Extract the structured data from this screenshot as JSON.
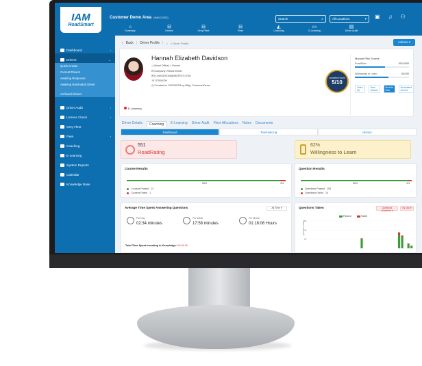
{
  "app": {
    "logo_line1": "IAM",
    "logo_line2": "RoadSmart",
    "title": "Customer Demo Area",
    "title_code": "(IMAC0203)",
    "search_placeholder": "Search",
    "location_value": "All Locations"
  },
  "nav_tiles": [
    {
      "label": "Summary",
      "icon": "home-icon"
    },
    {
      "label": "Drivers",
      "icon": "car-icon"
    },
    {
      "label": "Grey Fleet",
      "icon": "car-icon"
    },
    {
      "label": "Fleet",
      "icon": "car-icon"
    },
    {
      "label": "Coaching",
      "icon": "grad-cap-icon"
    },
    {
      "label": "E-Learning",
      "icon": "monitor-icon"
    },
    {
      "label": "Driver Audit",
      "icon": "clipboard-icon"
    }
  ],
  "sidebar": {
    "items": [
      {
        "label": "Dashboard"
      },
      {
        "label": "Drivers"
      }
    ],
    "driver_sub": [
      "Quick Create",
      "Current Drivers",
      "Awaiting Response",
      "Awaiting Nominated Driver",
      "Archived Drivers"
    ],
    "items2": [
      {
        "label": "Driver Audit"
      },
      {
        "label": "Licence Check"
      },
      {
        "label": "Grey Fleet"
      },
      {
        "label": "Fleet"
      },
      {
        "label": "Coaching"
      },
      {
        "label": "E-Learning"
      },
      {
        "label": "System Reports"
      },
      {
        "label": "Calendar"
      },
      {
        "label": "Knowledge Base"
      }
    ]
  },
  "breadcrumb": {
    "back": "Back",
    "title": "Driver Profile",
    "path": "> Driver Profile"
  },
  "actions_label": "Actions",
  "profile": {
    "name": "Hannah Elizabeth Davidson",
    "details": [
      "(Head Office) > Drivers",
      "Company Vehicle Driver",
      "H.DAVIDSON@IAMTEST.COM",
      "07000000",
      "Created on 15/03/2023 by Billy | CustomerDemo"
    ],
    "elearning_tag": "E-Learning",
    "combined_score_label": "Combined Score",
    "combined_score": "5/10"
  },
  "risk": {
    "title": "Module Risk Scores",
    "rows": [
      {
        "label": "RoadRider",
        "value": "551/1000",
        "fill": 0.551
      },
      {
        "label": "Willingness to Learn",
        "value": "62/100",
        "fill": 0.62
      }
    ],
    "tabs": [
      "Video (0)",
      "User Access",
      "Module Risk",
      "Nominated Drivers"
    ],
    "active_tab": "Module Risk"
  },
  "profile_tabs": [
    "Driver Details",
    "Coaching",
    "E-Learning",
    "Driver Audit",
    "Fleet Allocations",
    "Notes",
    "Documents"
  ],
  "profile_tab_active": "Coaching",
  "subtabs": [
    "Dashboard",
    "Telematics",
    "History"
  ],
  "subtab_active": "Dashboard",
  "road_rating": {
    "value": "551",
    "label": "RoadRating"
  },
  "willingness": {
    "value": "62%",
    "label": "Willingness to Learn"
  },
  "course_results": {
    "title": "Course Results",
    "passed_pct": 96,
    "failed_pct": 4,
    "passed_label": "96%",
    "failed_label": "4%",
    "legend": [
      {
        "label": "Courses Passed",
        "count": "22",
        "color": "#3a9c3a"
      },
      {
        "label": "Courses Failed",
        "count": "1",
        "color": "#d33333"
      }
    ]
  },
  "question_results": {
    "title": "Question Results",
    "passed_pct": 96,
    "failed_pct": 4,
    "passed_label": "96%",
    "failed_label": "4%",
    "legend": [
      {
        "label": "Questions Passed",
        "count": "105",
        "color": "#3a9c3a"
      },
      {
        "label": "Questions Failed",
        "count": "10",
        "color": "#d33333"
      }
    ]
  },
  "time_spent": {
    "title": "Average Time Spent Answering Questions",
    "dropdown": "All Time",
    "items": [
      {
        "period": "Per Day",
        "value": "02:34 minutes"
      },
      {
        "period": "Per Week",
        "value": "17:58 minutes"
      },
      {
        "period": "Per Month",
        "value": "01:18:06 Hours"
      }
    ],
    "total_label": "Total Time Spent Investing in Knowledge:",
    "total_value": "00:28:15"
  },
  "questions_taken": {
    "title": "Questions Taken",
    "dropdown1": "Questions Answered",
    "dropdown2": "By Day",
    "legend_passed": "Passed",
    "legend_failed": "Failed",
    "ylabel": "Questions Taken",
    "y_ticks": [
      "60",
      "40",
      "20"
    ]
  },
  "chart_data": {
    "type": "bar",
    "title": "Questions Taken",
    "ylabel": "Questions Taken",
    "ylim": [
      0,
      60
    ],
    "series": [
      {
        "name": "Passed",
        "values": [
          0,
          0,
          0,
          0,
          0,
          0,
          0,
          0,
          0,
          0,
          0,
          0,
          0,
          0,
          0,
          0,
          20,
          0,
          0,
          0,
          0,
          0,
          0,
          0,
          0,
          0,
          0,
          0,
          30,
          25,
          0,
          10,
          5
        ]
      },
      {
        "name": "Failed",
        "values": [
          0,
          0,
          0,
          0,
          0,
          0,
          0,
          0,
          0,
          0,
          0,
          0,
          0,
          0,
          0,
          0,
          2,
          0,
          0,
          0,
          0,
          0,
          0,
          0,
          0,
          0,
          0,
          0,
          5,
          3,
          0,
          1,
          1
        ]
      }
    ]
  }
}
